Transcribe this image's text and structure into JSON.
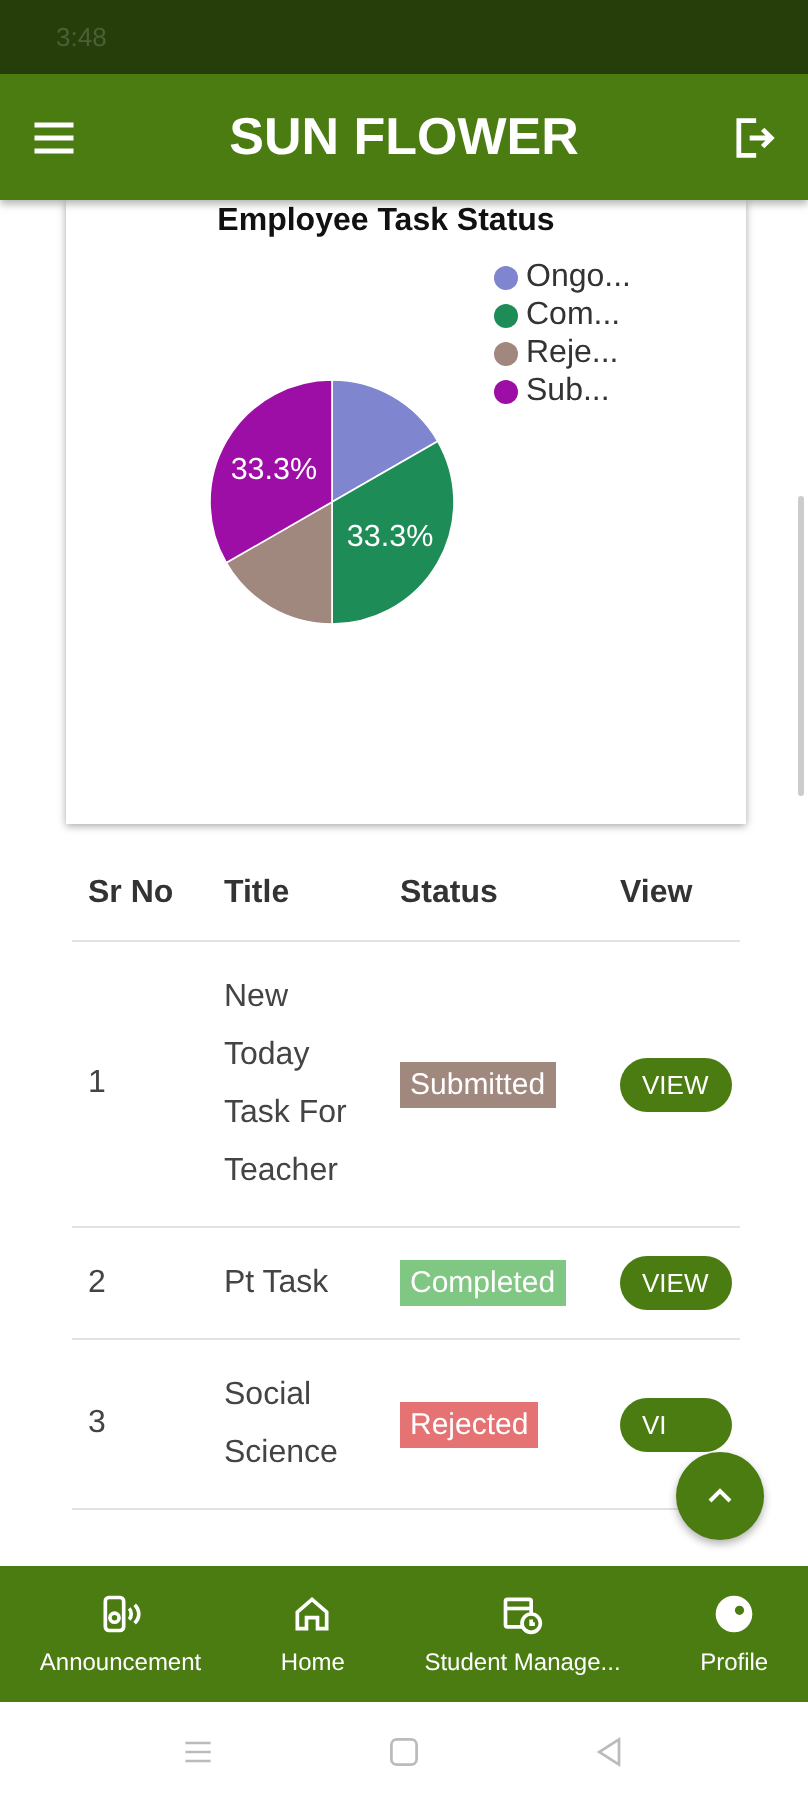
{
  "status_bar": {
    "time": "3:48"
  },
  "app_bar": {
    "title": "SUN FLOWER"
  },
  "chart_card": {
    "chart_data": {
      "type": "pie",
      "title": "Employee Task Status",
      "categories": [
        "Ongo...",
        "Com...",
        "Reje...",
        "Sub..."
      ],
      "values": [
        16.7,
        33.3,
        16.7,
        33.3
      ],
      "legend": true,
      "colors": [
        "#7f86cf",
        "#1e8c57",
        "#a1887f",
        "#9c0ea6"
      ],
      "value_labels": [
        null,
        "33.3%",
        null,
        "33.3%"
      ]
    }
  },
  "table": {
    "columns": [
      "Sr No",
      "Title",
      "Status",
      "View"
    ],
    "rows": [
      {
        "sr": "1",
        "title": "New Today Task For Teacher",
        "status": "Submitted",
        "color": "#a1887f",
        "view": "VIEW"
      },
      {
        "sr": "2",
        "title": "Pt Task",
        "status": "Completed",
        "color": "#81c784",
        "view": "VIEW"
      },
      {
        "sr": "3",
        "title": "Social Science",
        "status": "Rejected",
        "color": "#e57373",
        "view": "VI"
      }
    ]
  },
  "bottom_nav": [
    {
      "label": "Announcement",
      "kind": "speaker"
    },
    {
      "label": "Home",
      "kind": "home"
    },
    {
      "label": "Student Manage...",
      "kind": "calendar"
    },
    {
      "label": "Profile",
      "kind": "profile"
    }
  ]
}
